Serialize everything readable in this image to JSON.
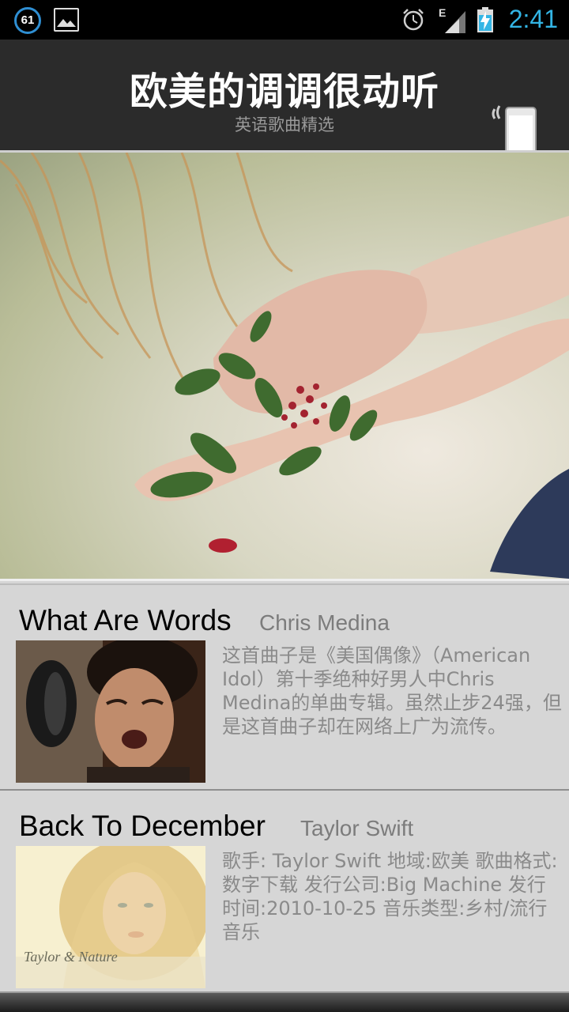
{
  "status_bar": {
    "notification_count": "61",
    "clock": "2:41",
    "icons": [
      "notification-badge-icon",
      "gallery-icon",
      "alarm-icon",
      "signal-edge-icon",
      "battery-charging-icon"
    ]
  },
  "header": {
    "title": "欧美的调调很动听",
    "subtitle": "英语歌曲精选",
    "icon": "phone-vibrate-icon"
  },
  "songs": [
    {
      "title": "What Are Words",
      "artist": "Chris Medina",
      "description": "这首曲子是《美国偶像》（American Idol）第十季绝种好男人中Chris Medina的单曲专辑。虽然止步24强，但是这首曲子却在网络上广为流传。"
    },
    {
      "title": "Back To December",
      "artist": "Taylor Swift",
      "description": "歌手: Taylor Swift  地域:欧美  歌曲格式:数字下载  发行公司:Big Machine  发行时间:2010-10-25  音乐类型:乡村/流行音乐",
      "thumb_caption": "Taylor & Nature"
    }
  ],
  "colors": {
    "status_accent": "#33b5e5",
    "header_bg": "#2b2b2b",
    "list_bg": "#d6d6d6"
  }
}
